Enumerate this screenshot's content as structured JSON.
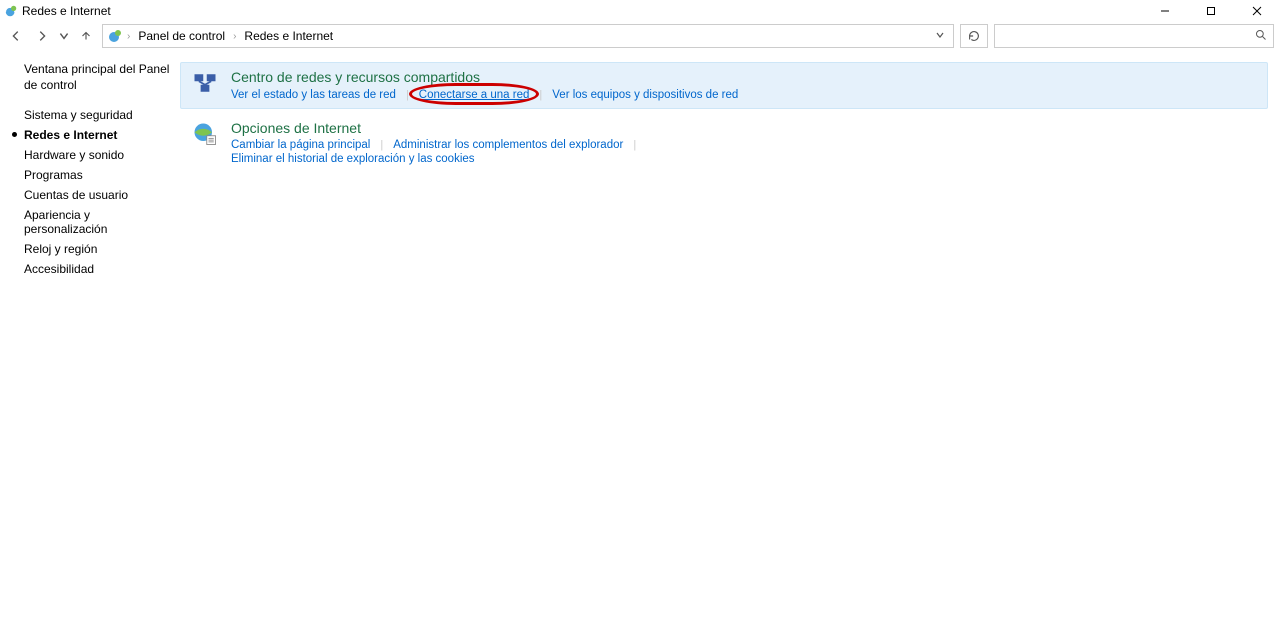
{
  "window": {
    "title": "Redes e Internet"
  },
  "breadcrumb": {
    "root": "Panel de control",
    "current": "Redes e Internet"
  },
  "search": {
    "placeholder": ""
  },
  "sidebar": {
    "home": "Ventana principal del Panel de control",
    "items": [
      {
        "label": "Sistema y seguridad",
        "active": false
      },
      {
        "label": "Redes e Internet",
        "active": true
      },
      {
        "label": "Hardware y sonido",
        "active": false
      },
      {
        "label": "Programas",
        "active": false
      },
      {
        "label": "Cuentas de usuario",
        "active": false
      },
      {
        "label": "Apariencia y personalización",
        "active": false
      },
      {
        "label": "Reloj y región",
        "active": false
      },
      {
        "label": "Accesibilidad",
        "active": false
      }
    ]
  },
  "main": {
    "panels": [
      {
        "id": "network-sharing-center",
        "title": "Centro de redes y recursos compartidos",
        "selected": true,
        "links": [
          {
            "label": "Ver el estado y las tareas de red",
            "circled": false
          },
          {
            "label": "Conectarse a una red",
            "circled": true
          },
          {
            "label": "Ver los equipos y dispositivos de red",
            "circled": false
          }
        ]
      },
      {
        "id": "internet-options",
        "title": "Opciones de Internet",
        "selected": false,
        "links": [
          {
            "label": "Cambiar la página principal",
            "circled": false
          },
          {
            "label": "Administrar los complementos del explorador",
            "circled": false
          },
          {
            "label": "Eliminar el historial de exploración y las cookies",
            "circled": false
          }
        ]
      }
    ]
  }
}
